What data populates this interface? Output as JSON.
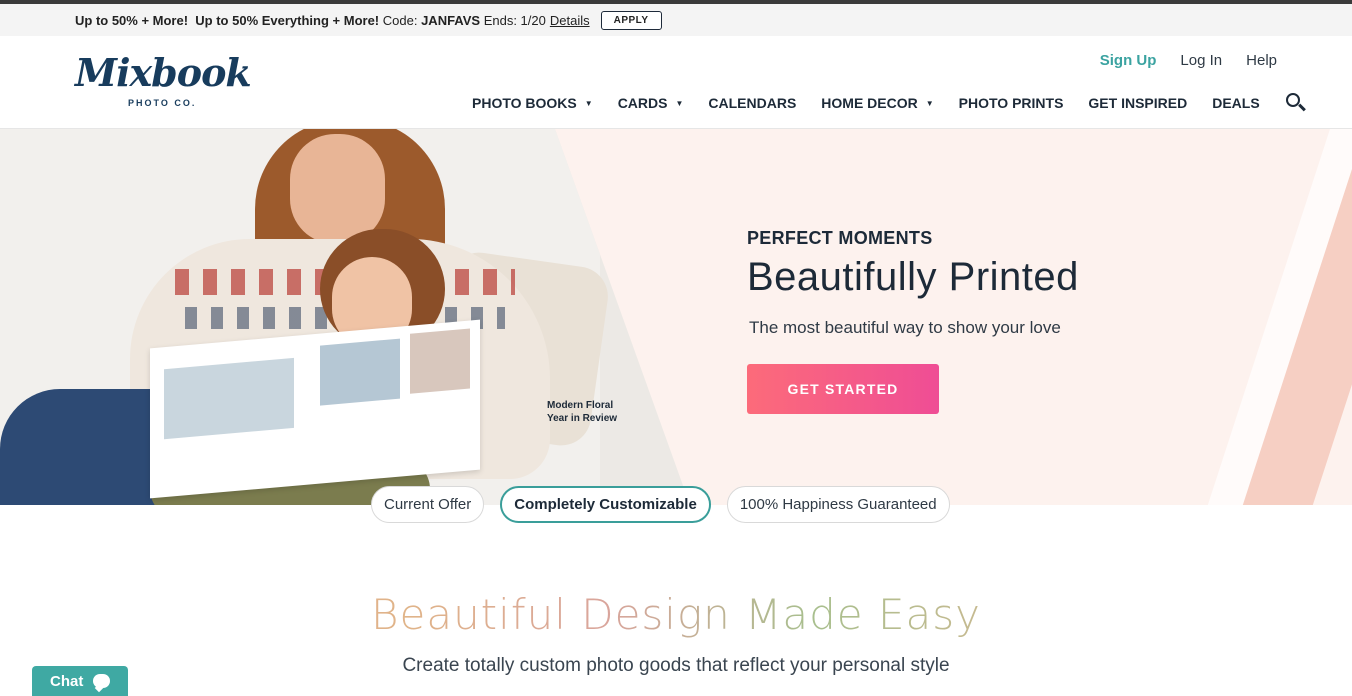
{
  "promo": {
    "part1": "Up to 50% + More!",
    "part2": "Up to 50% Everything + More!",
    "code_label": "Code:",
    "code": "JANFAVS",
    "ends": "Ends: 1/20",
    "details": "Details",
    "apply": "APPLY"
  },
  "logo": {
    "word": "Mixbook",
    "sub": "PHOTO CO."
  },
  "util": {
    "signup": "Sign Up",
    "login": "Log In",
    "help": "Help"
  },
  "nav": [
    {
      "label": "PHOTO BOOKS",
      "caret": true
    },
    {
      "label": "CARDS",
      "caret": true
    },
    {
      "label": "CALENDARS",
      "caret": false
    },
    {
      "label": "HOME DECOR",
      "caret": true
    },
    {
      "label": "PHOTO PRINTS",
      "caret": false
    },
    {
      "label": "GET INSPIRED",
      "caret": false
    },
    {
      "label": "DEALS",
      "caret": false
    }
  ],
  "hero": {
    "caption_line1": "Modern Floral",
    "caption_line2": "Year in Review",
    "eyebrow": "PERFECT MOMENTS",
    "headline": "Beautifully Printed",
    "subline": "The most beautiful way to show your love",
    "cta": "GET STARTED"
  },
  "pills": [
    {
      "label": "Current Offer",
      "active": false
    },
    {
      "label": "Completely Customizable",
      "active": true
    },
    {
      "label": "100% Happiness Guaranteed",
      "active": false
    }
  ],
  "section": {
    "title": "Beautiful Design Made Easy",
    "subtitle": "Create totally custom photo goods that reflect your personal style"
  },
  "chat": {
    "label": "Chat"
  },
  "colors": {
    "accent_teal": "#3ba3a1",
    "cta_start": "#fc6b7a",
    "cta_end": "#ef4d95",
    "navy": "#183c5d"
  }
}
